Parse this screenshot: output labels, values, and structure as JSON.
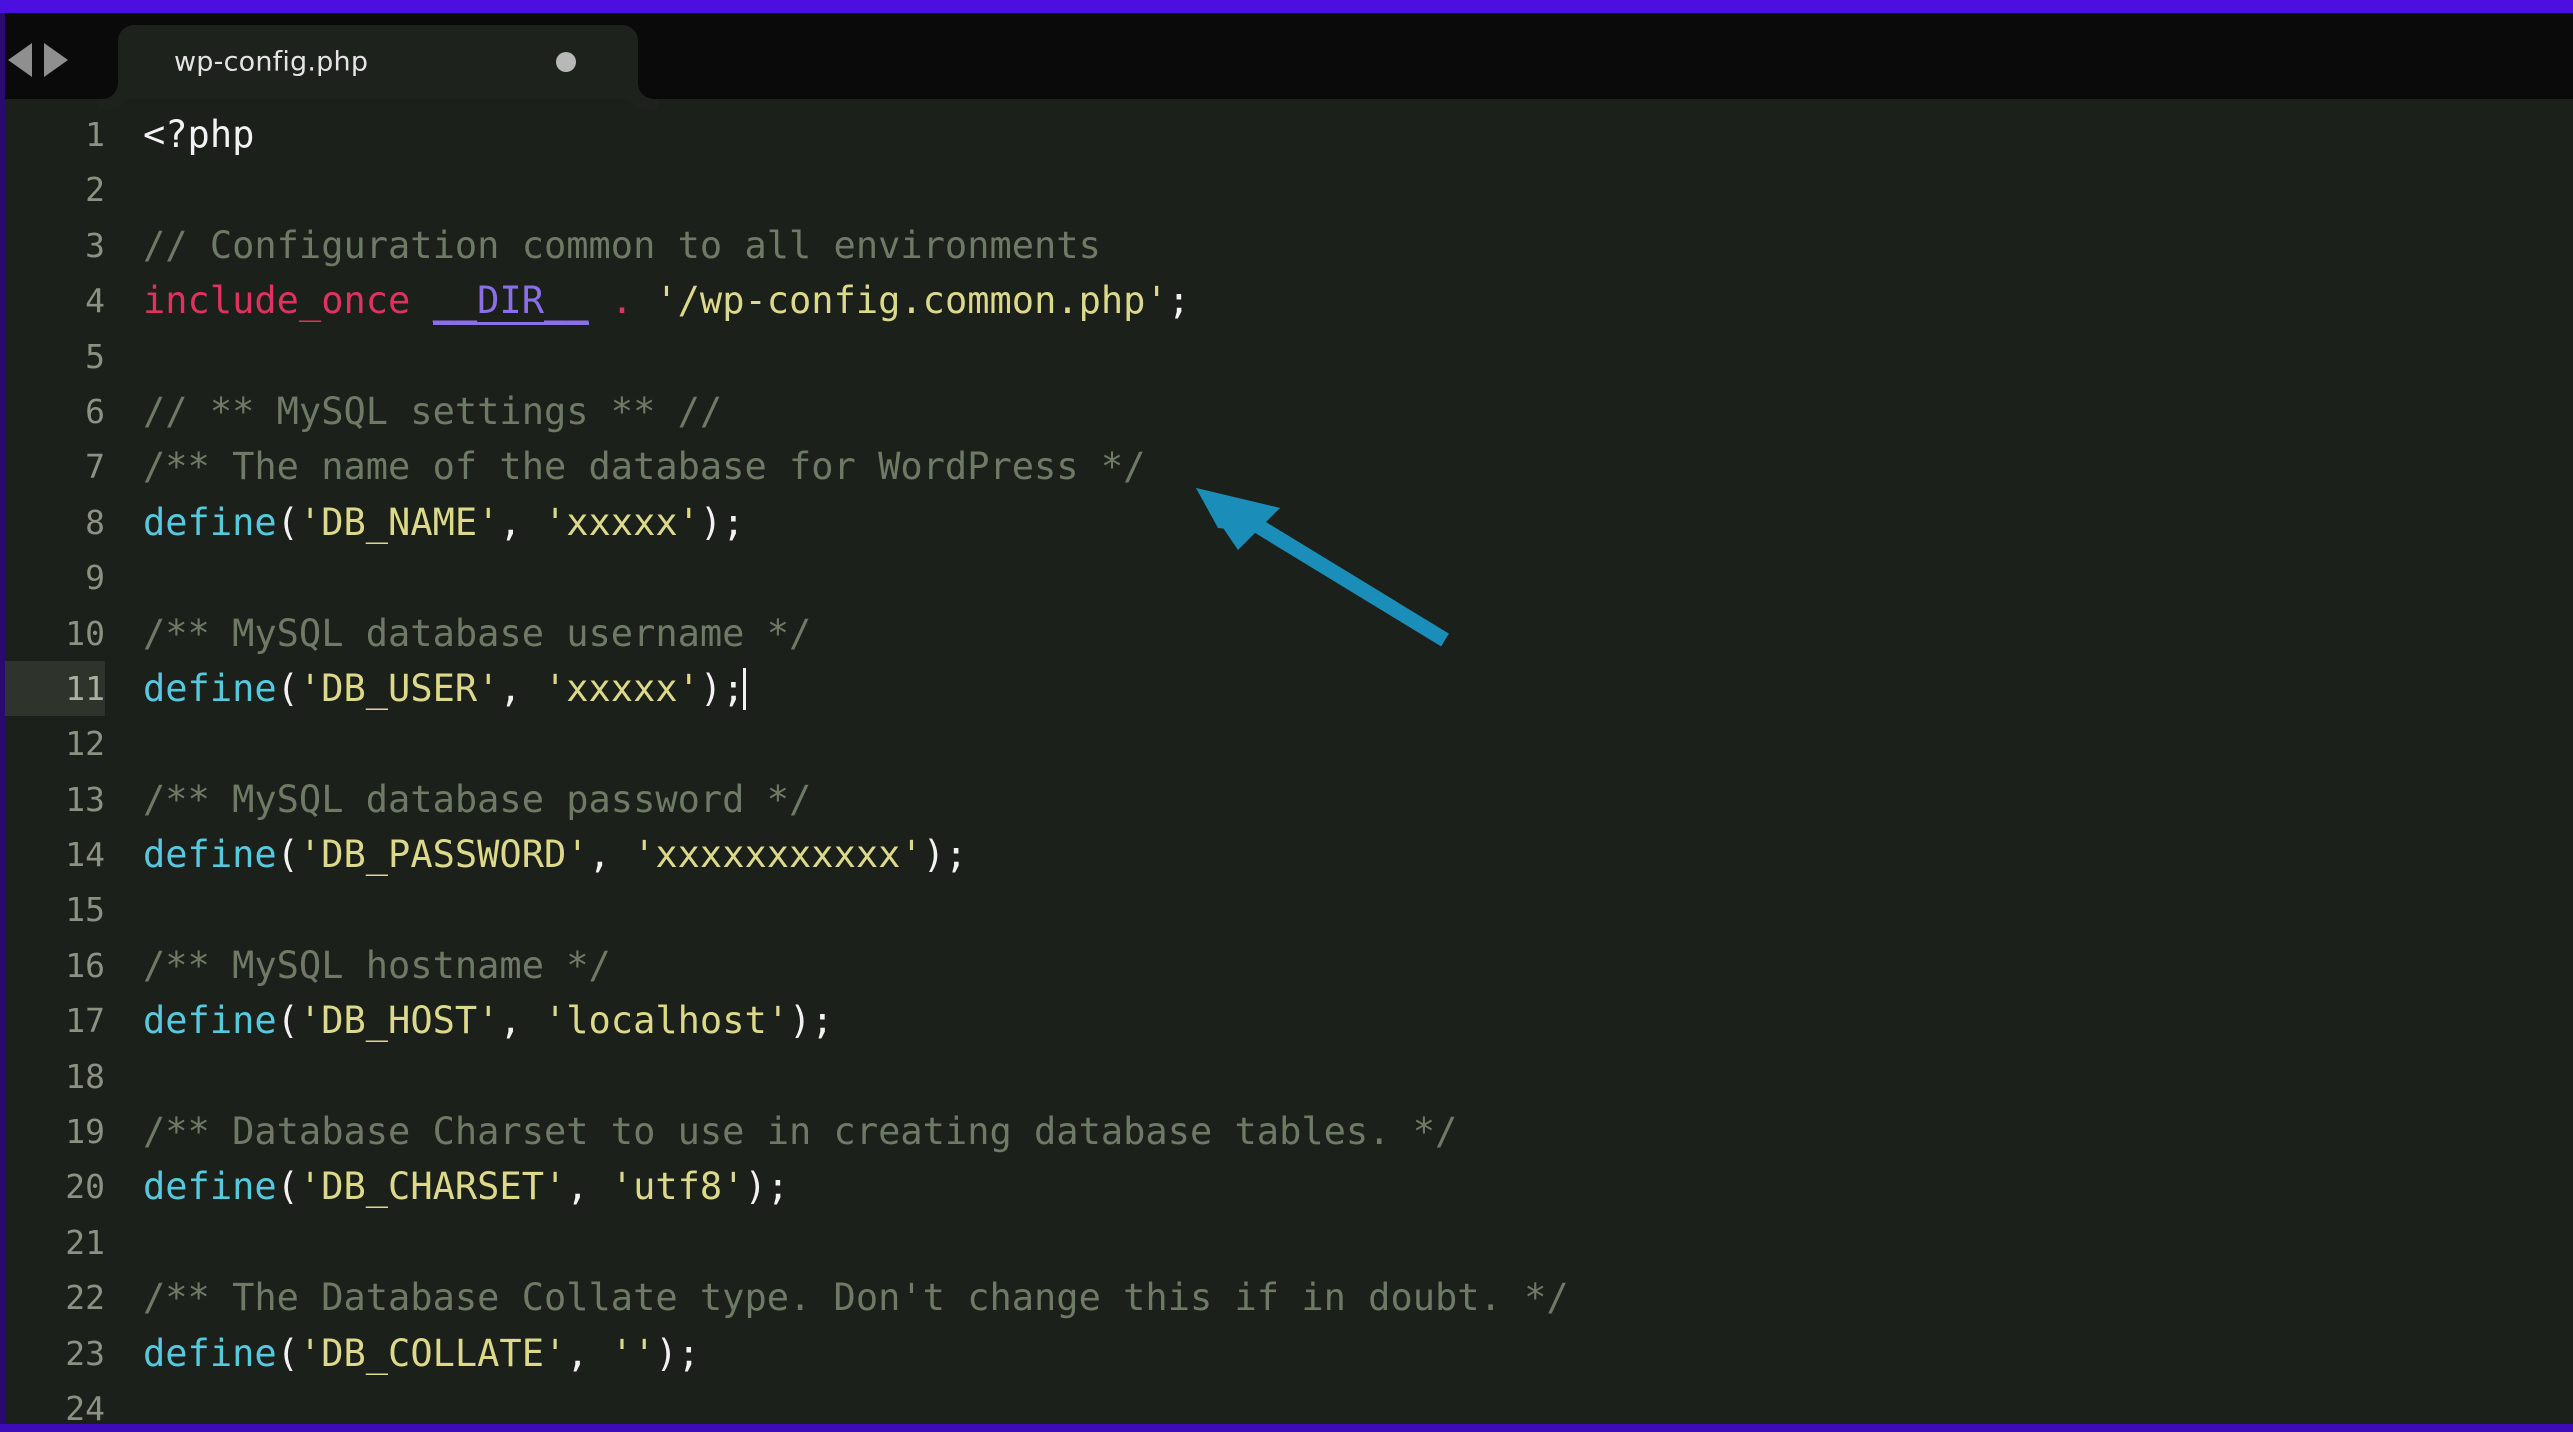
{
  "window": {
    "accent_color": "#4b0fe0",
    "editor_background": "#1c201a",
    "tabbar_background": "#0a0a0a"
  },
  "tabbar": {
    "nav_back_icon": "triangle-left-icon",
    "nav_forward_icon": "triangle-right-icon",
    "tabs": [
      {
        "label": "wp-config.php",
        "modified": true,
        "modified_indicator": "unsaved-dot",
        "active": true
      }
    ]
  },
  "editor": {
    "language": "php",
    "active_line": 11,
    "cursor_line": 11,
    "cursor_column": 25,
    "colors": {
      "comment": "#6f7a66",
      "keyword": "#e0315f",
      "magic_constant": "#8a6fe8",
      "string": "#ddd98a",
      "function": "#56c8e0",
      "plain": "#f2f2f2",
      "gutter": "#8b9183",
      "active_gutter_bg": "#2e332b"
    },
    "lines": [
      {
        "n": "1",
        "tokens": [
          {
            "c": "plain",
            "t": "<?php"
          }
        ]
      },
      {
        "n": "2",
        "tokens": []
      },
      {
        "n": "3",
        "tokens": [
          {
            "c": "comment",
            "t": "// Configuration common to all environments"
          }
        ]
      },
      {
        "n": "4",
        "tokens": [
          {
            "c": "keyword",
            "t": "include_once"
          },
          {
            "c": "plain",
            "t": " "
          },
          {
            "c": "magic",
            "t": "__DIR__"
          },
          {
            "c": "plain",
            "t": " "
          },
          {
            "c": "op",
            "t": "."
          },
          {
            "c": "plain",
            "t": " "
          },
          {
            "c": "string",
            "t": "'/wp-config.common.php'"
          },
          {
            "c": "punct",
            "t": ";"
          }
        ]
      },
      {
        "n": "5",
        "tokens": []
      },
      {
        "n": "6",
        "tokens": [
          {
            "c": "comment",
            "t": "// ** MySQL settings ** //"
          }
        ]
      },
      {
        "n": "7",
        "tokens": [
          {
            "c": "comment",
            "t": "/** The name of the database for WordPress */"
          }
        ]
      },
      {
        "n": "8",
        "tokens": [
          {
            "c": "func",
            "t": "define"
          },
          {
            "c": "punct",
            "t": "("
          },
          {
            "c": "string",
            "t": "'DB_NAME'"
          },
          {
            "c": "punct",
            "t": ", "
          },
          {
            "c": "string",
            "t": "'xxxxx'"
          },
          {
            "c": "punct",
            "t": ");"
          }
        ]
      },
      {
        "n": "9",
        "tokens": []
      },
      {
        "n": "10",
        "tokens": [
          {
            "c": "comment",
            "t": "/** MySQL database username */"
          }
        ]
      },
      {
        "n": "11",
        "tokens": [
          {
            "c": "func",
            "t": "define"
          },
          {
            "c": "punct",
            "t": "("
          },
          {
            "c": "string",
            "t": "'DB_USER'"
          },
          {
            "c": "punct",
            "t": ", "
          },
          {
            "c": "string",
            "t": "'xxxxx'"
          },
          {
            "c": "punct",
            "t": ");"
          }
        ],
        "active": true,
        "cursor_at_end": true
      },
      {
        "n": "12",
        "tokens": []
      },
      {
        "n": "13",
        "tokens": [
          {
            "c": "comment",
            "t": "/** MySQL database password */"
          }
        ]
      },
      {
        "n": "14",
        "tokens": [
          {
            "c": "func",
            "t": "define"
          },
          {
            "c": "punct",
            "t": "("
          },
          {
            "c": "string",
            "t": "'DB_PASSWORD'"
          },
          {
            "c": "punct",
            "t": ", "
          },
          {
            "c": "string",
            "t": "'xxxxxxxxxxx'"
          },
          {
            "c": "punct",
            "t": ");"
          }
        ]
      },
      {
        "n": "15",
        "tokens": []
      },
      {
        "n": "16",
        "tokens": [
          {
            "c": "comment",
            "t": "/** MySQL hostname */"
          }
        ]
      },
      {
        "n": "17",
        "tokens": [
          {
            "c": "func",
            "t": "define"
          },
          {
            "c": "punct",
            "t": "("
          },
          {
            "c": "string",
            "t": "'DB_HOST'"
          },
          {
            "c": "punct",
            "t": ", "
          },
          {
            "c": "string",
            "t": "'localhost'"
          },
          {
            "c": "punct",
            "t": ");"
          }
        ]
      },
      {
        "n": "18",
        "tokens": []
      },
      {
        "n": "19",
        "tokens": [
          {
            "c": "comment",
            "t": "/** Database Charset to use in creating database tables. */"
          }
        ]
      },
      {
        "n": "20",
        "tokens": [
          {
            "c": "func",
            "t": "define"
          },
          {
            "c": "punct",
            "t": "("
          },
          {
            "c": "string",
            "t": "'DB_CHARSET'"
          },
          {
            "c": "punct",
            "t": ", "
          },
          {
            "c": "string",
            "t": "'utf8'"
          },
          {
            "c": "punct",
            "t": ");"
          }
        ]
      },
      {
        "n": "21",
        "tokens": []
      },
      {
        "n": "22",
        "tokens": [
          {
            "c": "comment",
            "t": "/** The Database Collate type. Don't change this if in doubt. */"
          }
        ]
      },
      {
        "n": "23",
        "tokens": [
          {
            "c": "func",
            "t": "define"
          },
          {
            "c": "punct",
            "t": "("
          },
          {
            "c": "string",
            "t": "'DB_COLLATE'"
          },
          {
            "c": "punct",
            "t": ", "
          },
          {
            "c": "string",
            "t": "''"
          },
          {
            "c": "punct",
            "t": ");"
          }
        ]
      },
      {
        "n": "24",
        "tokens": []
      }
    ]
  },
  "annotation": {
    "type": "arrow",
    "color": "#1a8db8",
    "points_to_line": 8,
    "direction": "up-left"
  }
}
